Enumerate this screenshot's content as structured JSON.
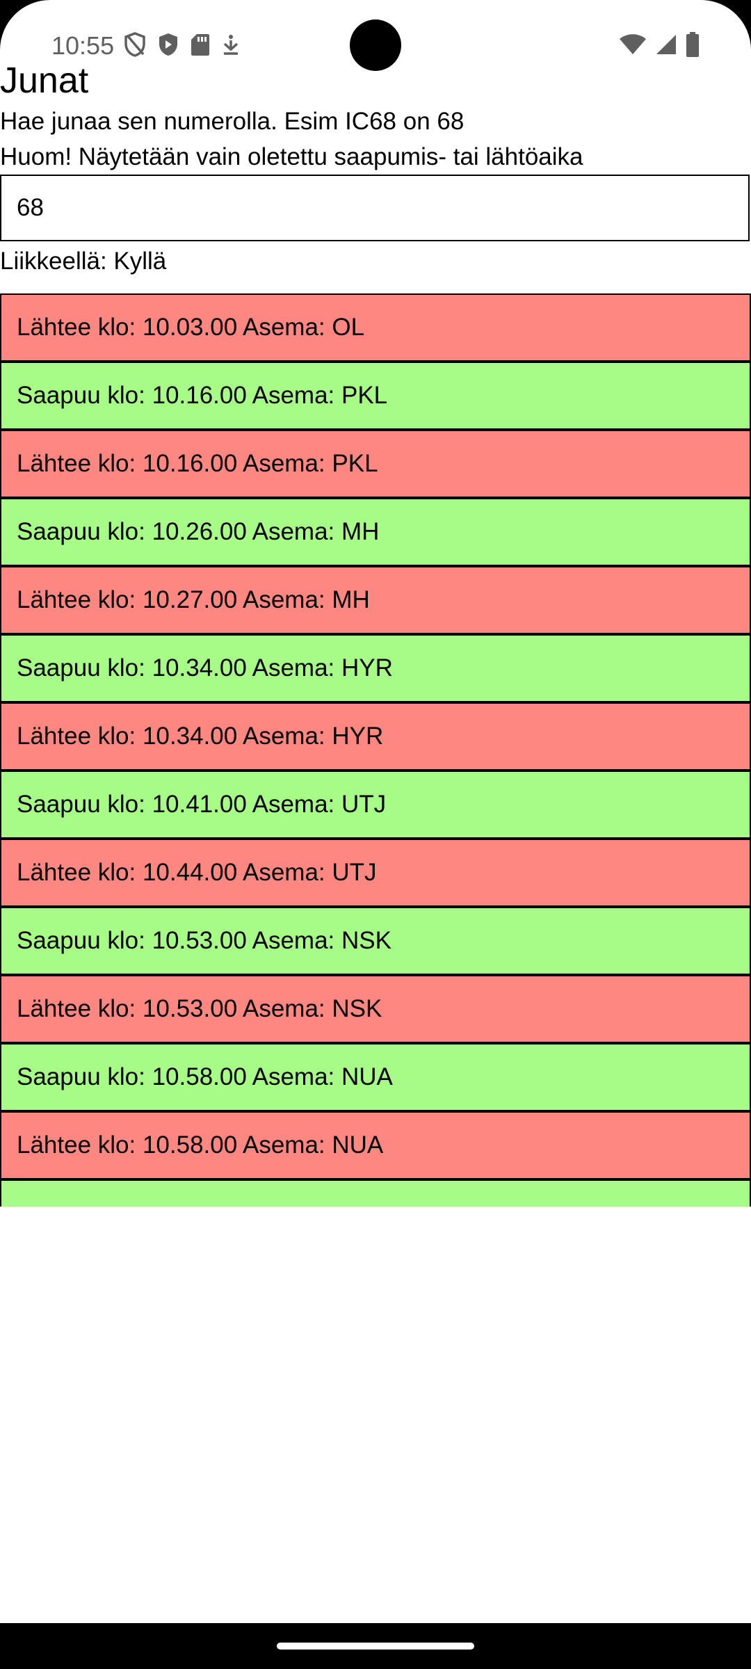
{
  "status_bar": {
    "time": "10:55",
    "left_icons": [
      "shield-off-icon",
      "shield-icon",
      "sd-card-icon",
      "download-icon"
    ],
    "right_icons": [
      "wifi-icon",
      "signal-icon",
      "battery-icon"
    ]
  },
  "app": {
    "title": "Junat",
    "description_1": "Hae junaa sen numerolla. Esim IC68 on 68",
    "description_2": "Huom! Näytetään vain oletettu saapumis- tai lähtöaika",
    "input_value": "68",
    "moving_status": "Liikkeellä: Kyllä"
  },
  "stops": [
    {
      "type": "depart",
      "text": "Lähtee klo: 10.03.00 Asema: OL"
    },
    {
      "type": "arrive",
      "text": "Saapuu klo: 10.16.00 Asema: PKL"
    },
    {
      "type": "depart",
      "text": "Lähtee klo: 10.16.00 Asema: PKL"
    },
    {
      "type": "arrive",
      "text": "Saapuu klo: 10.26.00 Asema: MH"
    },
    {
      "type": "depart",
      "text": "Lähtee klo: 10.27.00 Asema: MH"
    },
    {
      "type": "arrive",
      "text": "Saapuu klo: 10.34.00 Asema: HYR"
    },
    {
      "type": "depart",
      "text": "Lähtee klo: 10.34.00 Asema: HYR"
    },
    {
      "type": "arrive",
      "text": "Saapuu klo: 10.41.00 Asema: UTJ"
    },
    {
      "type": "depart",
      "text": "Lähtee klo: 10.44.00 Asema: UTJ"
    },
    {
      "type": "arrive",
      "text": "Saapuu klo: 10.53.00 Asema: NSK"
    },
    {
      "type": "depart",
      "text": "Lähtee klo: 10.53.00 Asema: NSK"
    },
    {
      "type": "arrive",
      "text": "Saapuu klo: 10.58.00 Asema: NUA"
    },
    {
      "type": "depart",
      "text": "Lähtee klo: 10.58.00 Asema: NUA"
    },
    {
      "type": "arrive",
      "text": ""
    }
  ],
  "colors": {
    "depart_row": "#ff8782",
    "arrive_row": "#a6fc86",
    "border": "#000000",
    "status_text": "#5f5f5f"
  }
}
